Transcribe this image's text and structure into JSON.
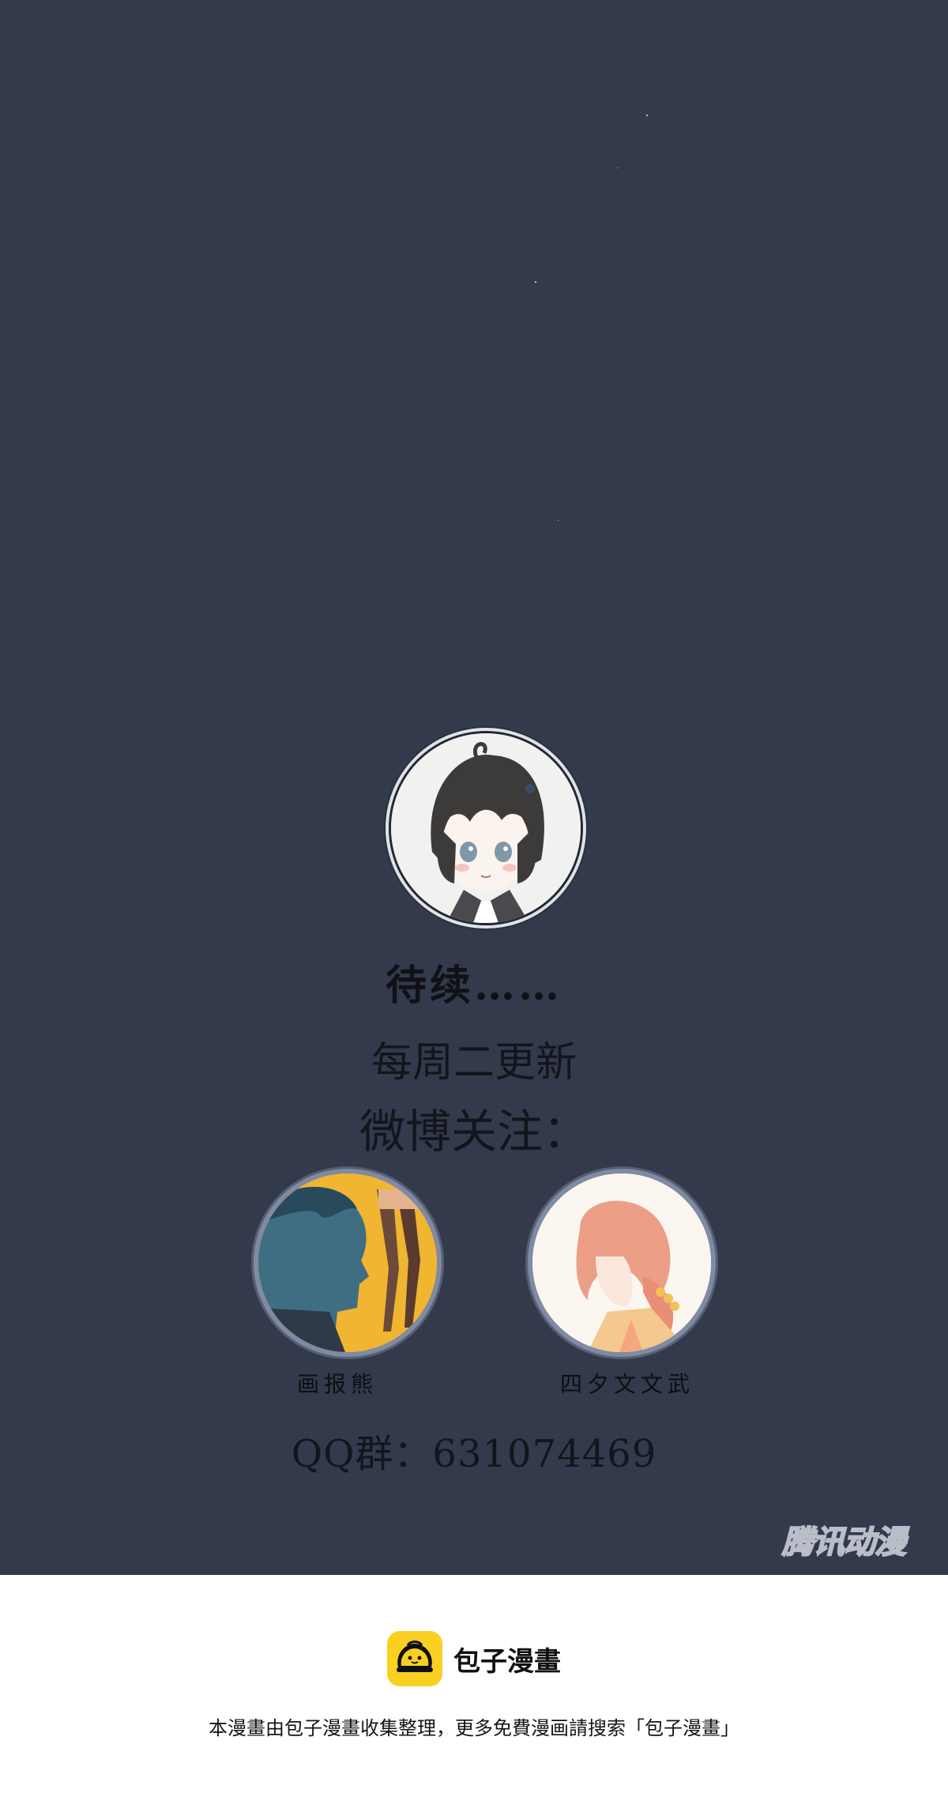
{
  "panel": {
    "background_color": "#333a4b",
    "to_be_continued": "待续……",
    "schedule": "每周二更新",
    "weibo_follow": "微博关注：",
    "authors": [
      {
        "name": "画报熊",
        "icon": "author-avatar-dark-haired-boy"
      },
      {
        "name": "四夕文文武",
        "icon": "author-avatar-pink-haired-girl"
      }
    ],
    "qq_group": "QQ群：631074469",
    "watermark": "腾讯动漫",
    "main_avatar_icon": "girl-portrait-avatar"
  },
  "footer": {
    "brand_name": "包子漫畫",
    "brand_logo_icon": "bun-logo-icon",
    "brand_color": "#f9d022",
    "note": "本漫畫由包子漫畫收集整理，更多免費漫画請搜索「包子漫畫」"
  }
}
